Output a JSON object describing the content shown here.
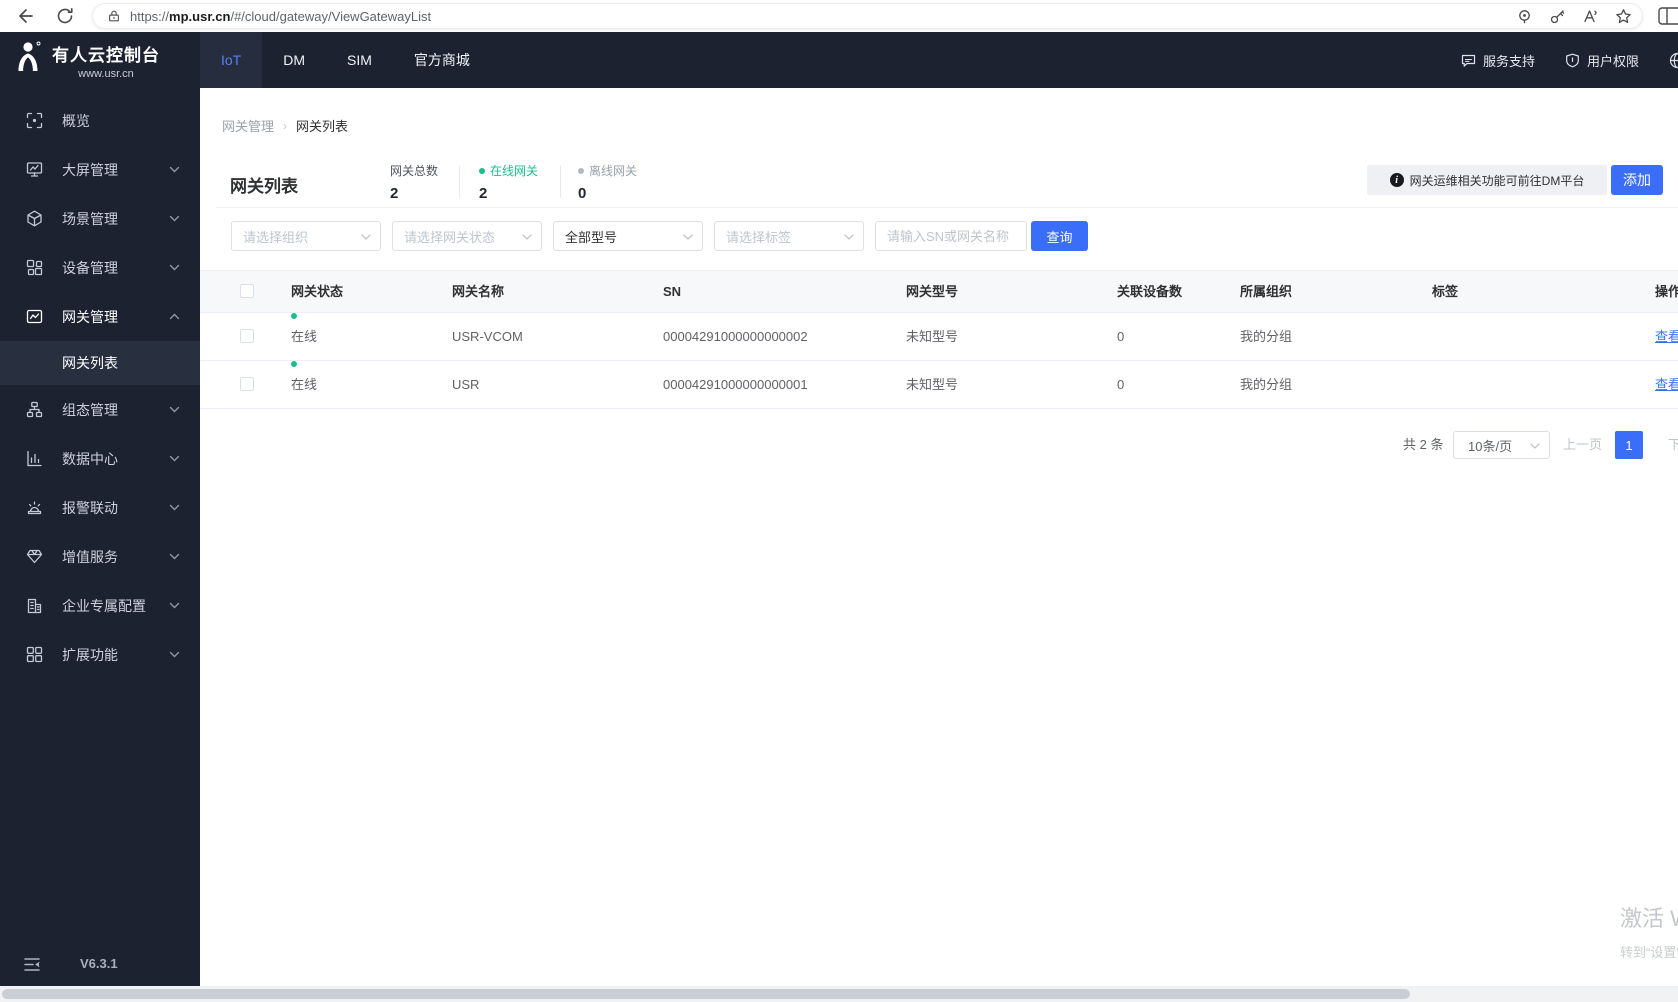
{
  "browser": {
    "url": {
      "scheme": "https://",
      "domain": "mp.usr.cn",
      "path": "/#/cloud/gateway/ViewGatewayList"
    }
  },
  "brand": {
    "title": "有人云控制台",
    "subtitle": "www.usr.cn"
  },
  "topnav": {
    "tabs": [
      {
        "label": "IoT"
      },
      {
        "label": "DM"
      },
      {
        "label": "SIM"
      },
      {
        "label": "官方商城"
      }
    ],
    "links": [
      {
        "label": "服务支持"
      },
      {
        "label": "用户权限"
      }
    ]
  },
  "sidebar": {
    "items": [
      {
        "label": "概览"
      },
      {
        "label": "大屏管理"
      },
      {
        "label": "场景管理"
      },
      {
        "label": "设备管理"
      },
      {
        "label": "网关管理"
      },
      {
        "label": "组态管理"
      },
      {
        "label": "数据中心"
      },
      {
        "label": "报警联动"
      },
      {
        "label": "增值服务"
      },
      {
        "label": "企业专属配置"
      },
      {
        "label": "扩展功能"
      }
    ],
    "submenu_active": "网关列表",
    "version": "V6.3.1"
  },
  "breadcrumb": {
    "items": [
      "网关管理",
      "网关列表"
    ],
    "separator": "›"
  },
  "page": {
    "title": "网关列表",
    "stats": [
      {
        "label": "网关总数",
        "value": "2"
      },
      {
        "label": "在线网关",
        "value": "2"
      },
      {
        "label": "离线网关",
        "value": "0"
      }
    ],
    "notice": "网关运维相关功能可前往DM平台",
    "notice_icon": "i",
    "add_button": "添加"
  },
  "filters": {
    "org_placeholder": "请选择组织",
    "status_placeholder": "请选择网关状态",
    "model_value": "全部型号",
    "tag_placeholder": "请选择标签",
    "search_placeholder": "请输入SN或网关名称",
    "search_button": "查询"
  },
  "table": {
    "headers": [
      "网关状态",
      "网关名称",
      "SN",
      "网关型号",
      "关联设备数",
      "所属组织",
      "标签",
      "操作"
    ],
    "rows": [
      {
        "status": "在线",
        "name": "USR-VCOM",
        "sn": "00004291000000000002",
        "model": "未知型号",
        "devices": "0",
        "org": "我的分组",
        "tag": "",
        "action": "查看"
      },
      {
        "status": "在线",
        "name": "USR",
        "sn": "00004291000000000001",
        "model": "未知型号",
        "devices": "0",
        "org": "我的分组",
        "tag": "",
        "action": "查看"
      }
    ]
  },
  "pagination": {
    "total": "共 2 条",
    "page_size": "10条/页",
    "prev": "上一页",
    "current": "1",
    "next": "下一页"
  },
  "watermark": {
    "line1": "激活 Windows",
    "line2": "转到“设置”以激活 Windows。"
  },
  "colors": {
    "primary": "#3a6ef8",
    "online_green": "#1cbe8f",
    "dark_bg": "#1d2231"
  }
}
